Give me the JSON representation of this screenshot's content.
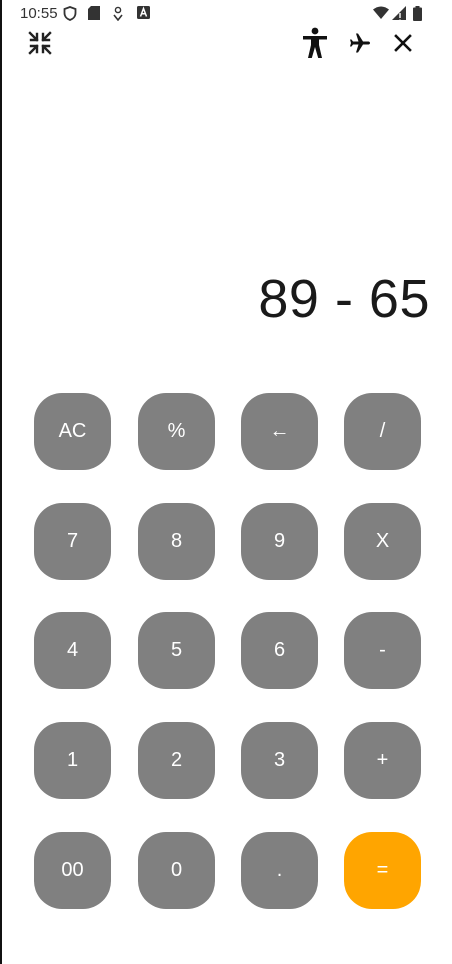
{
  "status_bar": {
    "time": "10:55",
    "left_icons": [
      "shield-icon",
      "sd-card-icon",
      "location-pin-icon",
      "a-badge-icon"
    ],
    "right_icons": [
      "wifi-icon",
      "signal-icon",
      "battery-icon"
    ]
  },
  "toolbar": {
    "left_icon": "collapse-icon",
    "right_icons": [
      "accessibility-icon",
      "airplane-icon",
      "close-icon"
    ]
  },
  "display": {
    "expression": "89 - 65"
  },
  "colors": {
    "key_background": "#808080",
    "key_text": "#ffffff",
    "equals_background": "#ffa500",
    "background": "#ffffff"
  },
  "keypad": {
    "rows": [
      [
        {
          "label": "AC",
          "name": "clear"
        },
        {
          "label": "%",
          "name": "percent"
        },
        {
          "label": "←",
          "name": "backspace"
        },
        {
          "label": "/",
          "name": "divide"
        }
      ],
      [
        {
          "label": "7",
          "name": "digit-7"
        },
        {
          "label": "8",
          "name": "digit-8"
        },
        {
          "label": "9",
          "name": "digit-9"
        },
        {
          "label": "X",
          "name": "multiply"
        }
      ],
      [
        {
          "label": "4",
          "name": "digit-4"
        },
        {
          "label": "5",
          "name": "digit-5"
        },
        {
          "label": "6",
          "name": "digit-6"
        },
        {
          "label": "-",
          "name": "subtract"
        }
      ],
      [
        {
          "label": "1",
          "name": "digit-1"
        },
        {
          "label": "2",
          "name": "digit-2"
        },
        {
          "label": "3",
          "name": "digit-3"
        },
        {
          "label": "+",
          "name": "add"
        }
      ],
      [
        {
          "label": "00",
          "name": "double-zero"
        },
        {
          "label": "0",
          "name": "digit-0"
        },
        {
          "label": ".",
          "name": "decimal"
        },
        {
          "label": "=",
          "name": "equals"
        }
      ]
    ]
  }
}
